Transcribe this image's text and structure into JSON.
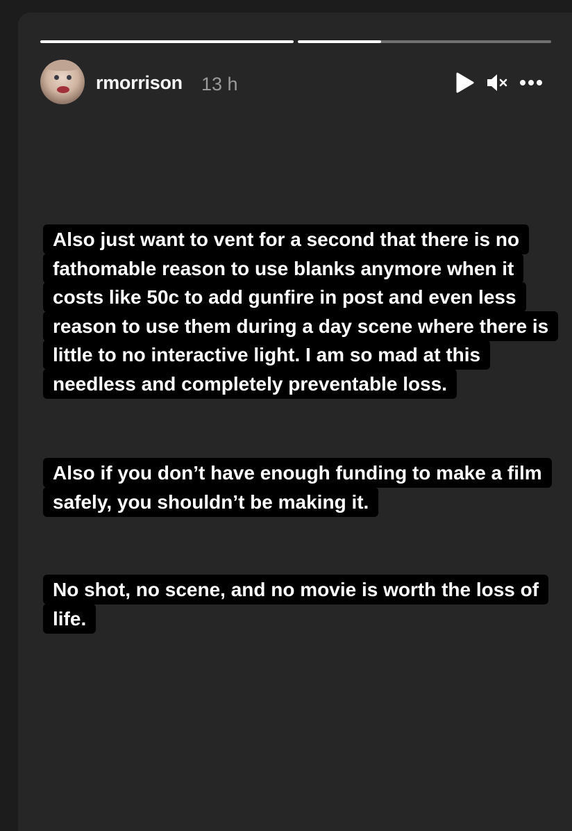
{
  "story": {
    "progress": [
      1.0,
      0.33
    ],
    "username": "rmorrison",
    "time": "13 h",
    "controls": {
      "play_icon": "play-icon",
      "mute_icon": "muted-speaker-icon",
      "more_icon": "more-options-icon"
    },
    "text_blocks": [
      "Also just want to vent for a second that there is no fathomable reason to use blanks anymore when it costs like 50c to add gunfire in post and even less reason to use them during a day scene where there is little to no interactive light.  I am so mad at this needless and completely preventable loss.",
      "Also if you don’t have enough funding to make a film safely, you shouldn’t be making it.",
      "No shot, no scene, and no movie is worth the loss of life."
    ]
  }
}
